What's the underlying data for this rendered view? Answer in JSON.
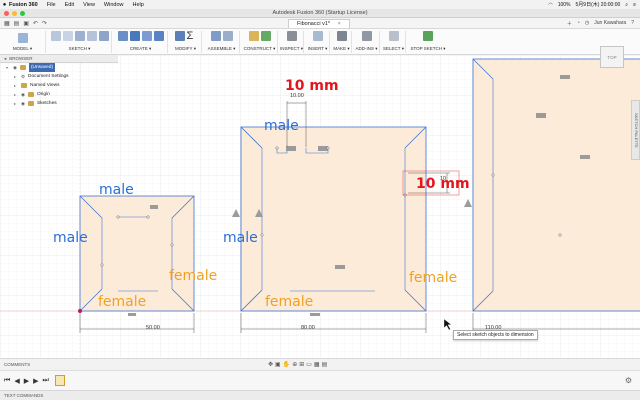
{
  "menubar": {
    "apple": "",
    "app_name": "Fusion 360",
    "items": [
      "File",
      "Edit",
      "View",
      "Window",
      "Help"
    ],
    "status": {
      "battery": "100%",
      "clock": "5月9日(木) 20:00:00"
    }
  },
  "window": {
    "title": "Autodesk Fusion 360 (Startup License)"
  },
  "appbar": {
    "doc_tab": "Fibonacci v1*",
    "user": "Jun Kawahara"
  },
  "toolbar": {
    "mode": "MODEL ▾",
    "groups": [
      "SKETCH ▾",
      "CREATE ▾",
      "MODIFY ▾",
      "ASSEMBLE ▾",
      "CONSTRUCT ▾",
      "INSPECT ▾",
      "INSERT ▾",
      "MAKE ▾",
      "ADD-INS ▾",
      "SELECT ▾",
      "STOP SKETCH ▾"
    ]
  },
  "browser": {
    "header": "BROWSER",
    "items": [
      {
        "label": "(Unsaved)",
        "level": 0
      },
      {
        "label": "Document Settings",
        "level": 1
      },
      {
        "label": "Named Views",
        "level": 1
      },
      {
        "label": "Origin",
        "level": 1
      },
      {
        "label": "Sketches",
        "level": 1
      }
    ]
  },
  "annotations": {
    "male_1": "male",
    "male_2": "male",
    "male_3": "male",
    "male_4": "male",
    "female_1": "female",
    "female_2": "female",
    "female_3": "female",
    "female_4": "female",
    "mm_1": "10 mm",
    "mm_2": "10 mm"
  },
  "dimensions": {
    "d1": "50.00",
    "d2": "80.00",
    "d3": "110.00",
    "d4": "10.00",
    "d5": "10"
  },
  "tooltip": "Select sketch objects to dimension",
  "bottom": {
    "comments": "COMMENTS",
    "text_commands": "TEXT COMMANDS"
  },
  "viewcube": "TOP",
  "palette_tab": "SKETCH PALETTE",
  "colors": {
    "male": "#2a6fd6",
    "female": "#f1a122",
    "dimension_callout": "#e2171d",
    "sketch_line": "#3e74d4",
    "profile_fill": "#fdebd9"
  }
}
